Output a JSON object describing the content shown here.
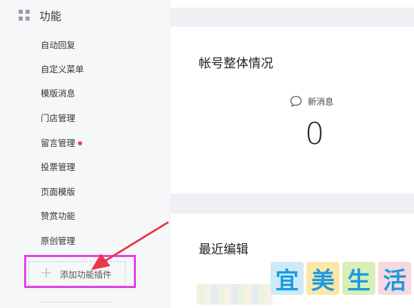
{
  "sidebar": {
    "section_title": "功能",
    "section_icon": "grid-icon",
    "items": [
      {
        "label": "自动回复"
      },
      {
        "label": "自定义菜单"
      },
      {
        "label": "模版消息"
      },
      {
        "label": "门店管理"
      },
      {
        "label": "留言管理",
        "badge": "red-dot"
      },
      {
        "label": "投票管理"
      },
      {
        "label": "页面模版"
      },
      {
        "label": "赞赏功能"
      },
      {
        "label": "原创管理"
      }
    ],
    "add_plugin": {
      "icon": "plus-icon",
      "label": "添加功能插件"
    }
  },
  "overview": {
    "title": "帐号整体情况",
    "new_messages_label": "新消息",
    "new_messages_icon": "chat-bubble-icon",
    "new_messages_count": "0"
  },
  "recent": {
    "title": "最近编辑"
  },
  "watermark": {
    "chars": [
      "宜",
      "美",
      "生",
      "活"
    ]
  },
  "colors": {
    "highlight": "#e040e8",
    "arrow": "#e8394a",
    "badge": "#e64340",
    "watermark_fg": "#1a9be0"
  }
}
